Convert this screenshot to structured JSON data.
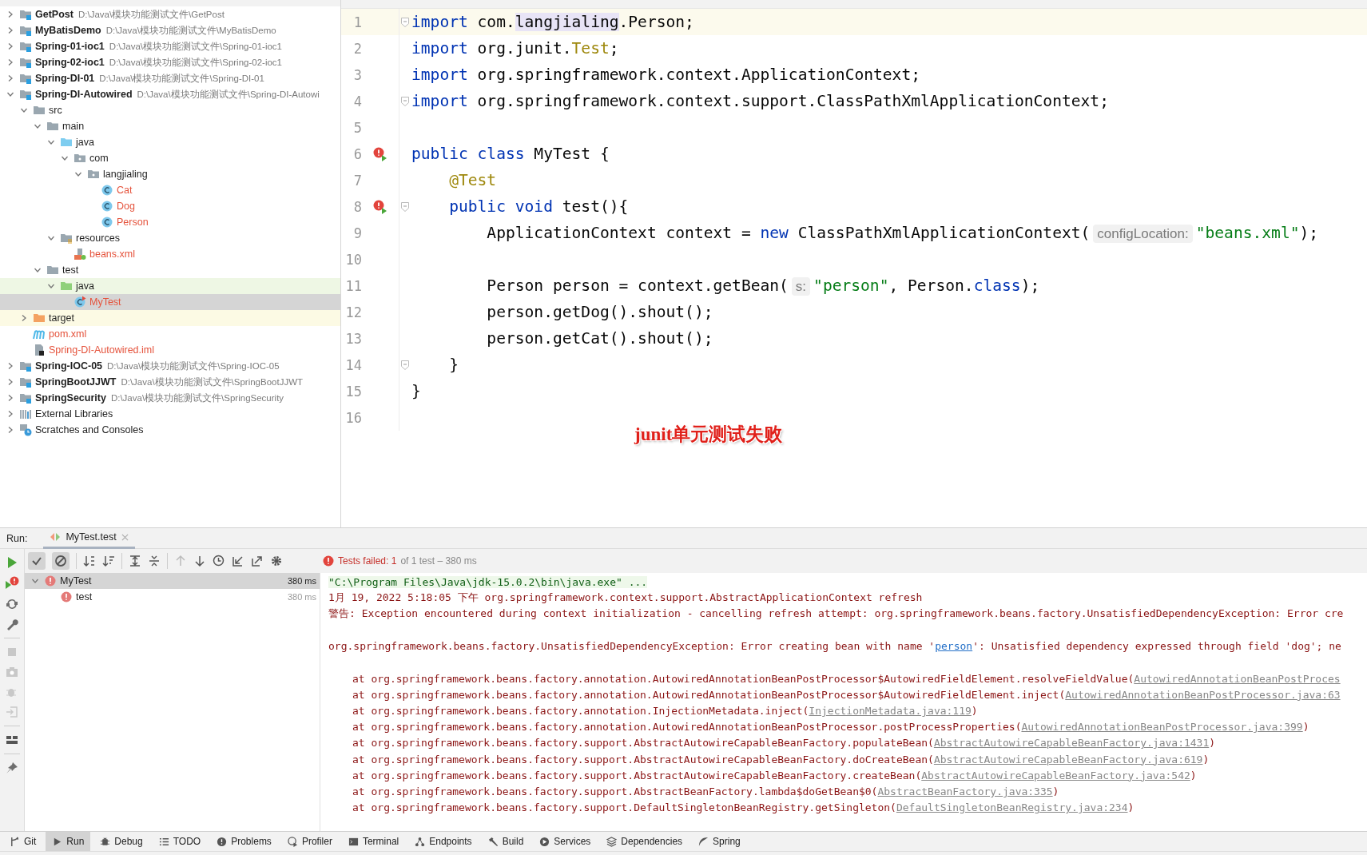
{
  "project_tree": {
    "items": [
      {
        "kind": "module",
        "label": "GetPost",
        "path": "D:\\Java\\模块功能测试文件\\GetPost",
        "expanded": false,
        "selected": false,
        "untracked": false
      },
      {
        "kind": "module",
        "label": "MyBatisDemo",
        "path": "D:\\Java\\模块功能测试文件\\MyBatisDemo",
        "expanded": false,
        "selected": false,
        "untracked": false
      },
      {
        "kind": "module",
        "label": "Spring-01-ioc1",
        "path": "D:\\Java\\模块功能测试文件\\Spring-01-ioc1",
        "expanded": false,
        "selected": false,
        "untracked": false
      },
      {
        "kind": "module",
        "label": "Spring-02-ioc1",
        "path": "D:\\Java\\模块功能测试文件\\Spring-02-ioc1",
        "expanded": false,
        "selected": false,
        "untracked": false
      },
      {
        "kind": "module",
        "label": "Spring-DI-01",
        "path": "D:\\Java\\模块功能测试文件\\Spring-DI-01",
        "expanded": false,
        "selected": false,
        "untracked": false
      },
      {
        "kind": "module",
        "label": "Spring-DI-Autowired",
        "path": "D:\\Java\\模块功能测试文件\\Spring-DI-Autowi",
        "expanded": true,
        "selected": false,
        "untracked": false,
        "children": [
          {
            "kind": "folder",
            "label": "src",
            "expanded": true,
            "selected": false,
            "untracked": false,
            "children": [
              {
                "kind": "folder",
                "label": "main",
                "expanded": true,
                "selected": false,
                "untracked": false,
                "children": [
                  {
                    "kind": "source-root",
                    "label": "java",
                    "expanded": true,
                    "selected": false,
                    "untracked": false,
                    "children": [
                      {
                        "kind": "package",
                        "label": "com",
                        "expanded": true,
                        "selected": false,
                        "untracked": false,
                        "children": [
                          {
                            "kind": "package",
                            "label": "langjialing",
                            "expanded": true,
                            "selected": false,
                            "untracked": false,
                            "children": [
                              {
                                "kind": "class",
                                "label": "Cat",
                                "selected": false,
                                "untracked": true
                              },
                              {
                                "kind": "class",
                                "label": "Dog",
                                "selected": false,
                                "untracked": true
                              },
                              {
                                "kind": "class",
                                "label": "Person",
                                "selected": false,
                                "untracked": true
                              }
                            ]
                          }
                        ]
                      }
                    ]
                  },
                  {
                    "kind": "resources-root",
                    "label": "resources",
                    "expanded": true,
                    "selected": false,
                    "untracked": false,
                    "children": [
                      {
                        "kind": "xml",
                        "label": "beans.xml",
                        "selected": false,
                        "untracked": true
                      }
                    ]
                  }
                ]
              },
              {
                "kind": "folder",
                "label": "test",
                "expanded": true,
                "selected": false,
                "untracked": false,
                "children": [
                  {
                    "kind": "test-root",
                    "label": "java",
                    "expanded": true,
                    "selected": false,
                    "untracked": false,
                    "children": [
                      {
                        "kind": "test-class",
                        "label": "MyTest",
                        "selected": true,
                        "untracked": true
                      }
                    ]
                  }
                ]
              }
            ]
          },
          {
            "kind": "excluded",
            "label": "target",
            "expanded": false,
            "selected": false,
            "untracked": false
          },
          {
            "kind": "maven",
            "label": "pom.xml",
            "selected": false,
            "untracked": true
          },
          {
            "kind": "iml",
            "label": "Spring-DI-Autowired.iml",
            "selected": false,
            "untracked": true
          }
        ]
      },
      {
        "kind": "module",
        "label": "Spring-IOC-05",
        "path": "D:\\Java\\模块功能测试文件\\Spring-IOC-05",
        "expanded": false,
        "selected": false,
        "untracked": false
      },
      {
        "kind": "module",
        "label": "SpringBootJJWT",
        "path": "D:\\Java\\模块功能测试文件\\SpringBootJJWT",
        "expanded": false,
        "selected": false,
        "untracked": false
      },
      {
        "kind": "module",
        "label": "SpringSecurity",
        "path": "D:\\Java\\模块功能测试文件\\SpringSecurity",
        "expanded": false,
        "selected": false,
        "untracked": false
      },
      {
        "kind": "libraries",
        "label": "External Libraries",
        "expanded": false,
        "selected": false,
        "untracked": false
      },
      {
        "kind": "scratches",
        "label": "Scratches and Consoles",
        "expanded": false,
        "selected": false,
        "untracked": false
      }
    ]
  },
  "editor": {
    "lines": [
      {
        "number": "1",
        "current": true,
        "run_marker": false,
        "fold": true,
        "tokens": [
          {
            "kind": "keyword",
            "text": "import"
          },
          {
            "kind": "plain",
            "text": " com."
          },
          {
            "kind": "highlight",
            "text": "langjialing"
          },
          {
            "kind": "plain",
            "text": ".Person;"
          }
        ]
      },
      {
        "number": "2",
        "current": false,
        "run_marker": false,
        "fold": false,
        "tokens": [
          {
            "kind": "keyword",
            "text": "import"
          },
          {
            "kind": "plain",
            "text": " org.junit."
          },
          {
            "kind": "annotation",
            "text": "Test"
          },
          {
            "kind": "plain",
            "text": ";"
          }
        ]
      },
      {
        "number": "3",
        "current": false,
        "run_marker": false,
        "fold": false,
        "tokens": [
          {
            "kind": "keyword",
            "text": "import"
          },
          {
            "kind": "plain",
            "text": " org.springframework.context.ApplicationContext;"
          }
        ]
      },
      {
        "number": "4",
        "current": false,
        "run_marker": false,
        "fold": true,
        "tokens": [
          {
            "kind": "keyword",
            "text": "import"
          },
          {
            "kind": "plain",
            "text": " org.springframework.context.support.ClassPathXmlApplicationContext;"
          }
        ]
      },
      {
        "number": "5",
        "current": false,
        "run_marker": false,
        "fold": false
      },
      {
        "number": "6",
        "current": false,
        "run_marker": true,
        "fold": false,
        "tokens": [
          {
            "kind": "keyword",
            "text": "public class"
          },
          {
            "kind": "plain",
            "text": " MyTest {"
          }
        ]
      },
      {
        "number": "7",
        "current": false,
        "run_marker": false,
        "fold": false,
        "tokens": [
          {
            "kind": "annotation",
            "text": "    @Test"
          }
        ]
      },
      {
        "number": "8",
        "current": false,
        "run_marker": true,
        "fold": true,
        "tokens": [
          {
            "kind": "keyword",
            "text": "    public void"
          },
          {
            "kind": "plain",
            "text": " test(){"
          }
        ]
      },
      {
        "number": "9",
        "current": false,
        "run_marker": false,
        "fold": false,
        "tokens": [
          {
            "kind": "plain",
            "text": "        ApplicationContext context = "
          },
          {
            "kind": "keyword",
            "text": "new"
          },
          {
            "kind": "plain",
            "text": " ClassPathXmlApplicationContext("
          },
          {
            "kind": "hint",
            "text": "configLocation:"
          },
          {
            "kind": "string",
            "text": "\"beans.xml\""
          },
          {
            "kind": "plain",
            "text": ");"
          }
        ]
      },
      {
        "number": "10",
        "current": false,
        "run_marker": false,
        "fold": false
      },
      {
        "number": "11",
        "current": false,
        "run_marker": false,
        "fold": false,
        "tokens": [
          {
            "kind": "plain",
            "text": "        Person person = context.getBean("
          },
          {
            "kind": "hint",
            "text": "s:"
          },
          {
            "kind": "string",
            "text": "\"person\""
          },
          {
            "kind": "plain",
            "text": ", Person."
          },
          {
            "kind": "keyword",
            "text": "class"
          },
          {
            "kind": "plain",
            "text": ");"
          }
        ]
      },
      {
        "number": "12",
        "current": false,
        "run_marker": false,
        "fold": false,
        "tokens": [
          {
            "kind": "plain",
            "text": "        person.getDog().shout();"
          }
        ]
      },
      {
        "number": "13",
        "current": false,
        "run_marker": false,
        "fold": false,
        "tokens": [
          {
            "kind": "plain",
            "text": "        person.getCat().shout();"
          }
        ]
      },
      {
        "number": "14",
        "current": false,
        "run_marker": false,
        "fold": true,
        "tokens": [
          {
            "kind": "plain",
            "text": "    }"
          }
        ]
      },
      {
        "number": "15",
        "current": false,
        "run_marker": false,
        "fold": false,
        "tokens": [
          {
            "kind": "plain",
            "text": "}"
          }
        ]
      },
      {
        "number": "16",
        "current": false,
        "run_marker": false,
        "fold": false
      }
    ],
    "overlay_note": "junit单元测试失败"
  },
  "run_panel": {
    "label": "Run:",
    "tab": {
      "label": "MyTest.test",
      "selected": true
    },
    "toolbar_toggles": [
      {
        "kind": "show-passed",
        "on": true
      },
      {
        "kind": "show-ignored",
        "on": true
      }
    ],
    "status": {
      "label": "Tests failed: 1",
      "detail": "of 1 test – 380 ms"
    },
    "tests": [
      {
        "name": "MyTest",
        "time": "380 ms",
        "selected": true,
        "expanded": true,
        "children": [
          {
            "name": "test",
            "time": "380 ms",
            "selected": false
          }
        ]
      }
    ],
    "console": [
      {
        "kind": "command",
        "text": "\"C:\\Program Files\\Java\\jdk-15.0.2\\bin\\java.exe\" ..."
      },
      {
        "kind": "error",
        "text": "1月 19, 2022 5:18:05 下午 org.springframework.context.support.AbstractApplicationContext refresh"
      },
      {
        "kind": "error",
        "text": "警告: Exception encountered during context initialization - cancelling refresh attempt: org.springframework.beans.factory.UnsatisfiedDependencyException: Error cre"
      },
      {
        "kind": "blank"
      },
      {
        "kind": "error",
        "text": "org.springframework.beans.factory.UnsatisfiedDependencyException: Error creating bean with name '",
        "link": "person",
        "after": "': Unsatisfied dependency expressed through field 'dog'; ne"
      },
      {
        "kind": "blank"
      },
      {
        "kind": "stack",
        "text": "at org.springframework.beans.factory.annotation.AutowiredAnnotationBeanPostProcessor$AutowiredFieldElement.resolveFieldValue(",
        "link": "AutowiredAnnotationBeanPostProces"
      },
      {
        "kind": "stack",
        "text": "at org.springframework.beans.factory.annotation.AutowiredAnnotationBeanPostProcessor$AutowiredFieldElement.inject(",
        "link": "AutowiredAnnotationBeanPostProcessor.java:63"
      },
      {
        "kind": "stack",
        "text": "at org.springframework.beans.factory.annotation.InjectionMetadata.inject(",
        "link": "InjectionMetadata.java:119",
        "after": ")"
      },
      {
        "kind": "stack",
        "text": "at org.springframework.beans.factory.annotation.AutowiredAnnotationBeanPostProcessor.postProcessProperties(",
        "link": "AutowiredAnnotationBeanPostProcessor.java:399",
        "after": ")"
      },
      {
        "kind": "stack",
        "text": "at org.springframework.beans.factory.support.AbstractAutowireCapableBeanFactory.populateBean(",
        "link": "AbstractAutowireCapableBeanFactory.java:1431",
        "after": ")"
      },
      {
        "kind": "stack",
        "text": "at org.springframework.beans.factory.support.AbstractAutowireCapableBeanFactory.doCreateBean(",
        "link": "AbstractAutowireCapableBeanFactory.java:619",
        "after": ")"
      },
      {
        "kind": "stack",
        "text": "at org.springframework.beans.factory.support.AbstractAutowireCapableBeanFactory.createBean(",
        "link": "AbstractAutowireCapableBeanFactory.java:542",
        "after": ")"
      },
      {
        "kind": "stack",
        "text": "at org.springframework.beans.factory.support.AbstractBeanFactory.lambda$doGetBean$0(",
        "link": "AbstractBeanFactory.java:335",
        "after": ")"
      },
      {
        "kind": "stack",
        "text": "at org.springframework.beans.factory.support.DefaultSingletonBeanRegistry.getSingleton(",
        "link": "DefaultSingletonBeanRegistry.java:234",
        "after": ")"
      }
    ]
  },
  "tool_strip": [
    {
      "kind": "git",
      "label": "Git",
      "selected": false
    },
    {
      "kind": "run",
      "label": "Run",
      "selected": true
    },
    {
      "kind": "debug",
      "label": "Debug",
      "selected": false
    },
    {
      "kind": "todo",
      "label": "TODO",
      "selected": false
    },
    {
      "kind": "problems",
      "label": "Problems",
      "selected": false
    },
    {
      "kind": "profiler",
      "label": "Profiler",
      "selected": false
    },
    {
      "kind": "terminal",
      "label": "Terminal",
      "selected": false
    },
    {
      "kind": "endpoints",
      "label": "Endpoints",
      "selected": false
    },
    {
      "kind": "build",
      "label": "Build",
      "selected": false
    },
    {
      "kind": "services",
      "label": "Services",
      "selected": false
    },
    {
      "kind": "dependencies",
      "label": "Dependencies",
      "selected": false
    },
    {
      "kind": "spring",
      "label": "Spring",
      "selected": false
    }
  ]
}
